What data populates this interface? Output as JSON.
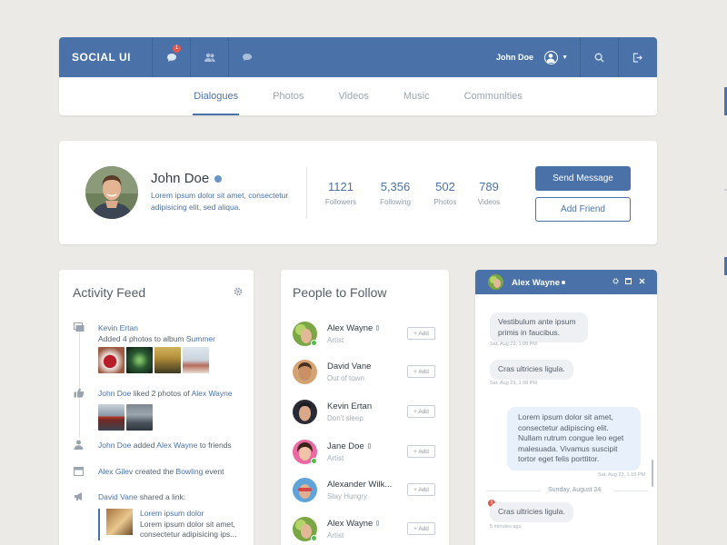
{
  "header": {
    "brand": "SOCIAL UI",
    "notification_count": "1",
    "user_name": "John Doe",
    "tabs": [
      {
        "label": "Dialogues",
        "active": true
      },
      {
        "label": "Photos",
        "active": false
      },
      {
        "label": "Videos",
        "active": false
      },
      {
        "label": "Music",
        "active": false
      },
      {
        "label": "Communities",
        "active": false
      }
    ]
  },
  "profile": {
    "name": "John Doe",
    "bio": "Lorem ipsum dolor sit amet, consectetur adipisicing elit, sed aliqua.",
    "stats": [
      {
        "value": "1121",
        "label": "Followers"
      },
      {
        "value": "5,356",
        "label": "Following"
      },
      {
        "value": "502",
        "label": "Photos"
      },
      {
        "value": "789",
        "label": "Videos"
      }
    ],
    "send_message": "Send Message",
    "add_friend": "Add Friend"
  },
  "activity": {
    "title": "Activity Feed",
    "a1": {
      "user": "Kevin Ertan",
      "text": "Added 4 photos to album ",
      "album": "Summer"
    },
    "a2": {
      "user": "John Doe",
      "text": " liked 2 photos of ",
      "target": "Alex Wayne"
    },
    "a3": {
      "user": "John Doe",
      "text": " added ",
      "target": "Alex Wayne",
      "tail": " to friends"
    },
    "a4": {
      "user": "Alex Gilev",
      "text": " created the ",
      "target": "Bowling",
      "tail": " event"
    },
    "a5": {
      "user": "David Vane",
      "text": " shared a link:"
    },
    "link": {
      "title": "Lorem ipsum dolor",
      "body": "Lorem ipsum dolor sit amet, consectetur adipisicing ips..."
    }
  },
  "people": {
    "title": "People to Follow",
    "add_label": "+ Add",
    "items": [
      {
        "name": "Alex Wayne",
        "sub": "Artist"
      },
      {
        "name": "David Vane",
        "sub": "Out of town"
      },
      {
        "name": "Kevin Ertan",
        "sub": "Don't sleep"
      },
      {
        "name": "Jane Doe",
        "sub": "Artist"
      },
      {
        "name": "Alexander Wilk...",
        "sub": "Stay Hungry"
      },
      {
        "name": "Alex Wayne",
        "sub": "Artist"
      }
    ]
  },
  "chat": {
    "name": "Alex Wayne",
    "messages": [
      {
        "text": "Vestibulum ante ipsum primis in faucibus.",
        "time": "Sat, Aug 23, 1:08 PM"
      },
      {
        "text": "Cras ultricies ligula.",
        "time": "Sat, Aug 23, 1:08 PM"
      },
      {
        "text": "Lorem ipsum dolor sit amet, consectetur adipiscing elit. Nullam rutrum congue leo eget malesuada. Vivamus suscipit tortor eget felis porttitor.",
        "time": "Sat, Aug 23, 1:10 PM"
      },
      {
        "text": "Cras ultricies ligula.",
        "time": "5 minutes ago"
      }
    ],
    "day_separator": "Sunday, August 24",
    "error_mark": "!"
  }
}
